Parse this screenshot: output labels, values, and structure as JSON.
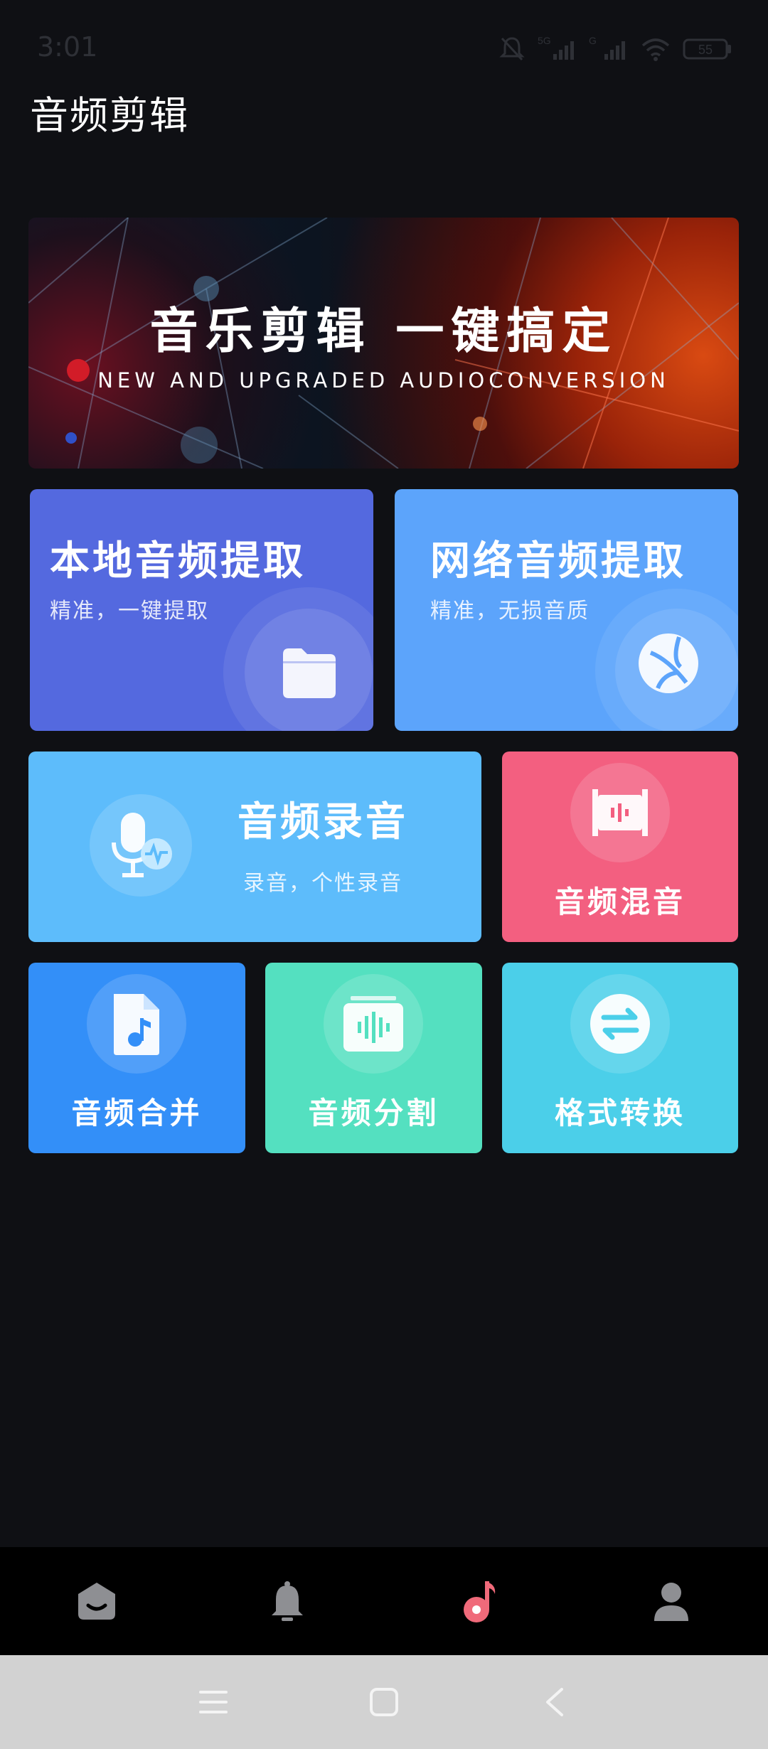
{
  "status_bar": {
    "time": "3:01",
    "battery": "55",
    "network_1": "5G",
    "network_2": "G"
  },
  "app": {
    "title": "音频剪辑"
  },
  "banner": {
    "title": "音乐剪辑  一键搞定",
    "subtitle": "NEW AND UPGRADED AUDIOCONVERSION"
  },
  "cards": {
    "local_extract": {
      "title": "本地音频提取",
      "subtitle": "精准，一键提取",
      "icon": "folder-icon",
      "color": "#5469df"
    },
    "net_extract": {
      "title": "网络音频提取",
      "subtitle": "精准，无损音质",
      "icon": "globe-icon",
      "color": "#5ca4fb"
    },
    "record": {
      "title": "音频录音",
      "subtitle": "录音，个性录音",
      "icon": "microphone-icon",
      "color": "#5dbcfb"
    },
    "mix": {
      "title": "音频混音",
      "icon": "mixer-icon",
      "color": "#f35f80"
    },
    "merge": {
      "title": "音频合并",
      "icon": "music-file-icon",
      "color": "#338ff8"
    },
    "split": {
      "title": "音频分割",
      "icon": "waveform-icon",
      "color": "#54e0c0"
    },
    "convert": {
      "title": "格式转换",
      "icon": "swap-icon",
      "color": "#4bcfe9"
    }
  },
  "bottom_nav": {
    "items": [
      {
        "icon": "home-icon"
      },
      {
        "icon": "bell-icon"
      },
      {
        "icon": "music-note-icon",
        "active": true
      },
      {
        "icon": "profile-icon"
      }
    ],
    "active_color": "#f06a7a"
  },
  "system_nav": {
    "icons": [
      "menu-icon",
      "home-square-icon",
      "back-icon"
    ]
  }
}
